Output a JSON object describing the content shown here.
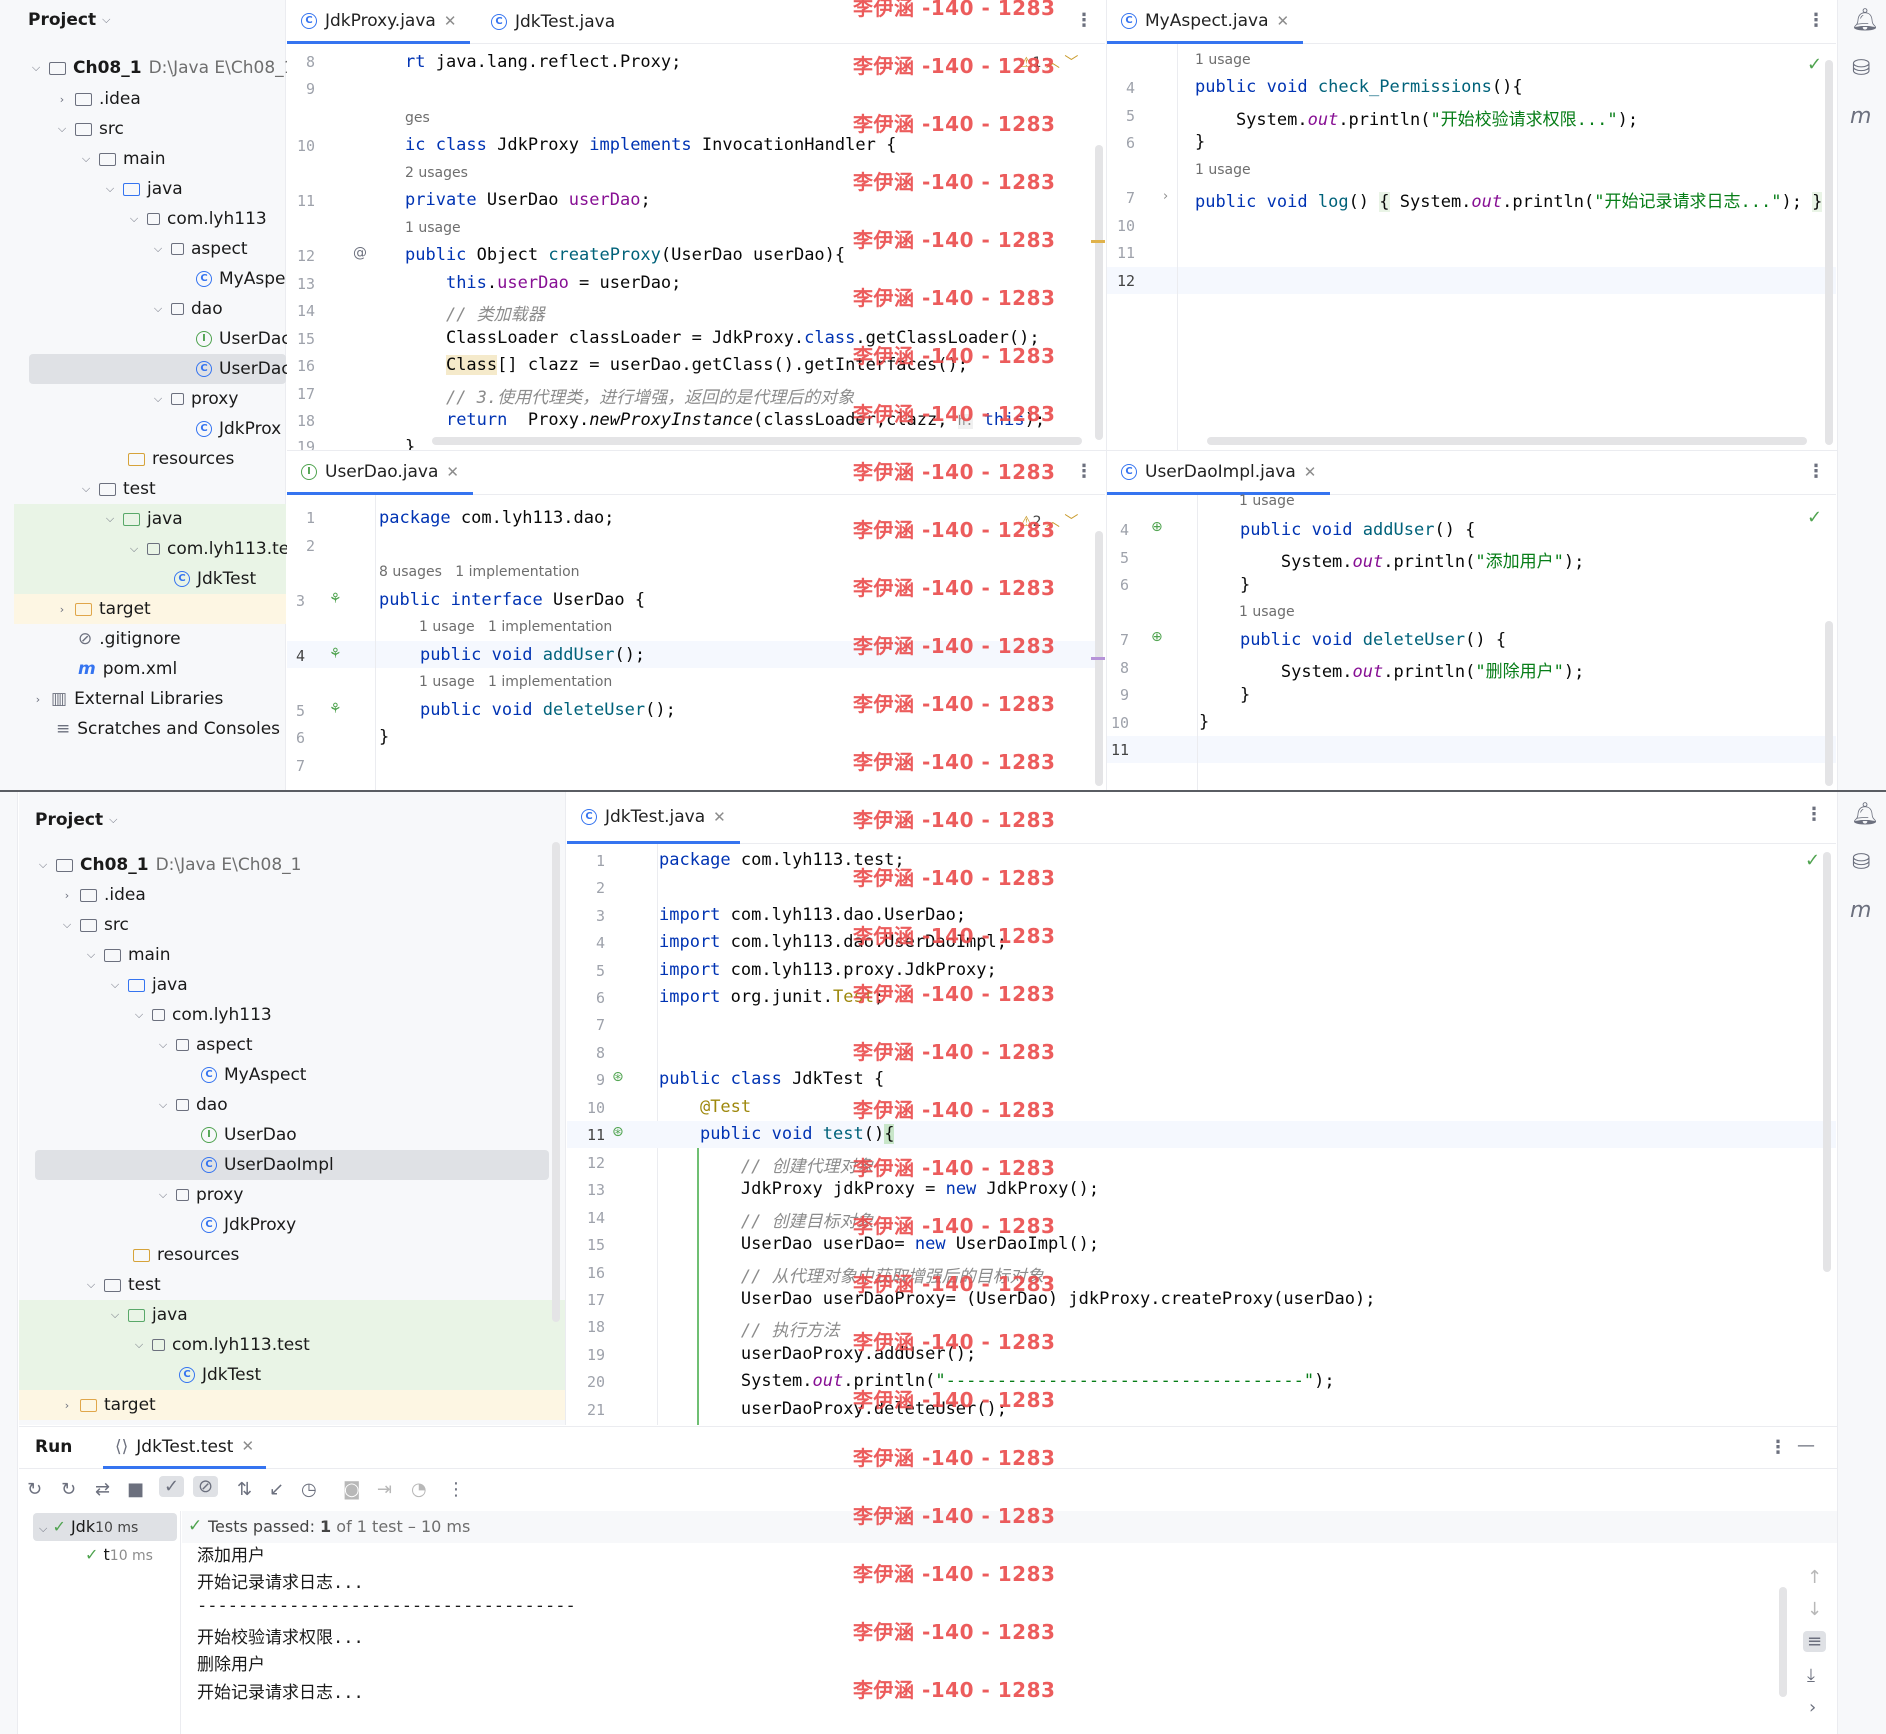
{
  "watermark": "李伊涵 -140 - 1283",
  "top": {
    "project": {
      "title": "Project",
      "root": "Ch08_1",
      "root_path": "D:\\Java E\\Ch08_1",
      "items": [
        ".idea",
        "src",
        "main",
        "java",
        "com.lyh113",
        "aspect",
        "MyAspe",
        "dao",
        "UserDac",
        "UserDac",
        "proxy",
        "JdkProx",
        "resources",
        "test",
        "java",
        "com.lyh113.tes",
        "JdkTest",
        "target",
        ".gitignore",
        "pom.xml",
        "External Libraries",
        "Scratches and Consoles"
      ]
    },
    "editor1": {
      "tabs": [
        "JdkProxy.java",
        "JdkTest.java"
      ],
      "warn": "1",
      "lines": [
        "8",
        "9",
        "10",
        "11",
        "12",
        "13",
        "14",
        "15",
        "16",
        "17",
        "18",
        "19"
      ],
      "hints": [
        "ges",
        "2 usages",
        "1 usage"
      ]
    },
    "editor2": {
      "tabs": [
        "MyAspect.java"
      ],
      "lines": [
        "4",
        "5",
        "6",
        "7",
        "10",
        "11",
        "12"
      ],
      "hints": [
        "1 usage",
        "1 usage"
      ]
    },
    "editor3": {
      "tabs": [
        "UserDao.java"
      ],
      "warn": "2",
      "lines": [
        "1",
        "2",
        "3",
        "4",
        "5",
        "6",
        "7"
      ],
      "hints": [
        "8 usages",
        "1 implementation",
        "1 usage",
        "1 implementation",
        "1 usage",
        "1 implementation"
      ]
    },
    "editor4": {
      "tabs": [
        "UserDaoImpl.java"
      ],
      "lines": [
        "4",
        "5",
        "6",
        "7",
        "8",
        "9",
        "10",
        "11"
      ],
      "hints": [
        "1 usage",
        "1 usage"
      ]
    }
  },
  "bottom": {
    "project": {
      "title": "Project",
      "root": "Ch08_1",
      "root_path": "D:\\Java E\\Ch08_1",
      "items": [
        ".idea",
        "src",
        "main",
        "java",
        "com.lyh113",
        "aspect",
        "MyAspect",
        "dao",
        "UserDao",
        "UserDaoImpl",
        "proxy",
        "JdkProxy",
        "resources",
        "test",
        "java",
        "com.lyh113.test",
        "JdkTest",
        "target"
      ]
    },
    "editor": {
      "tabs": [
        "JdkTest.java"
      ],
      "lines": [
        "1",
        "2",
        "3",
        "4",
        "5",
        "6",
        "7",
        "8",
        "9",
        "10",
        "11",
        "12",
        "13",
        "14",
        "15",
        "16",
        "17",
        "18",
        "19",
        "20",
        "21"
      ]
    },
    "run": {
      "tab_run": "Run",
      "tab_test": "JdkTest.test",
      "tree_root": "Jdk",
      "tree_root_time": "10 ms",
      "tree_child": "t",
      "tree_child_time": "10 ms",
      "status_label": "Tests passed:",
      "status_count": "1",
      "status_rest": "of 1 test – 10 ms",
      "output": [
        "添加用户",
        "开始记录请求日志...",
        "-------------------------------------",
        "开始校验请求权限...",
        "删除用户",
        "开始记录请求日志..."
      ]
    }
  }
}
